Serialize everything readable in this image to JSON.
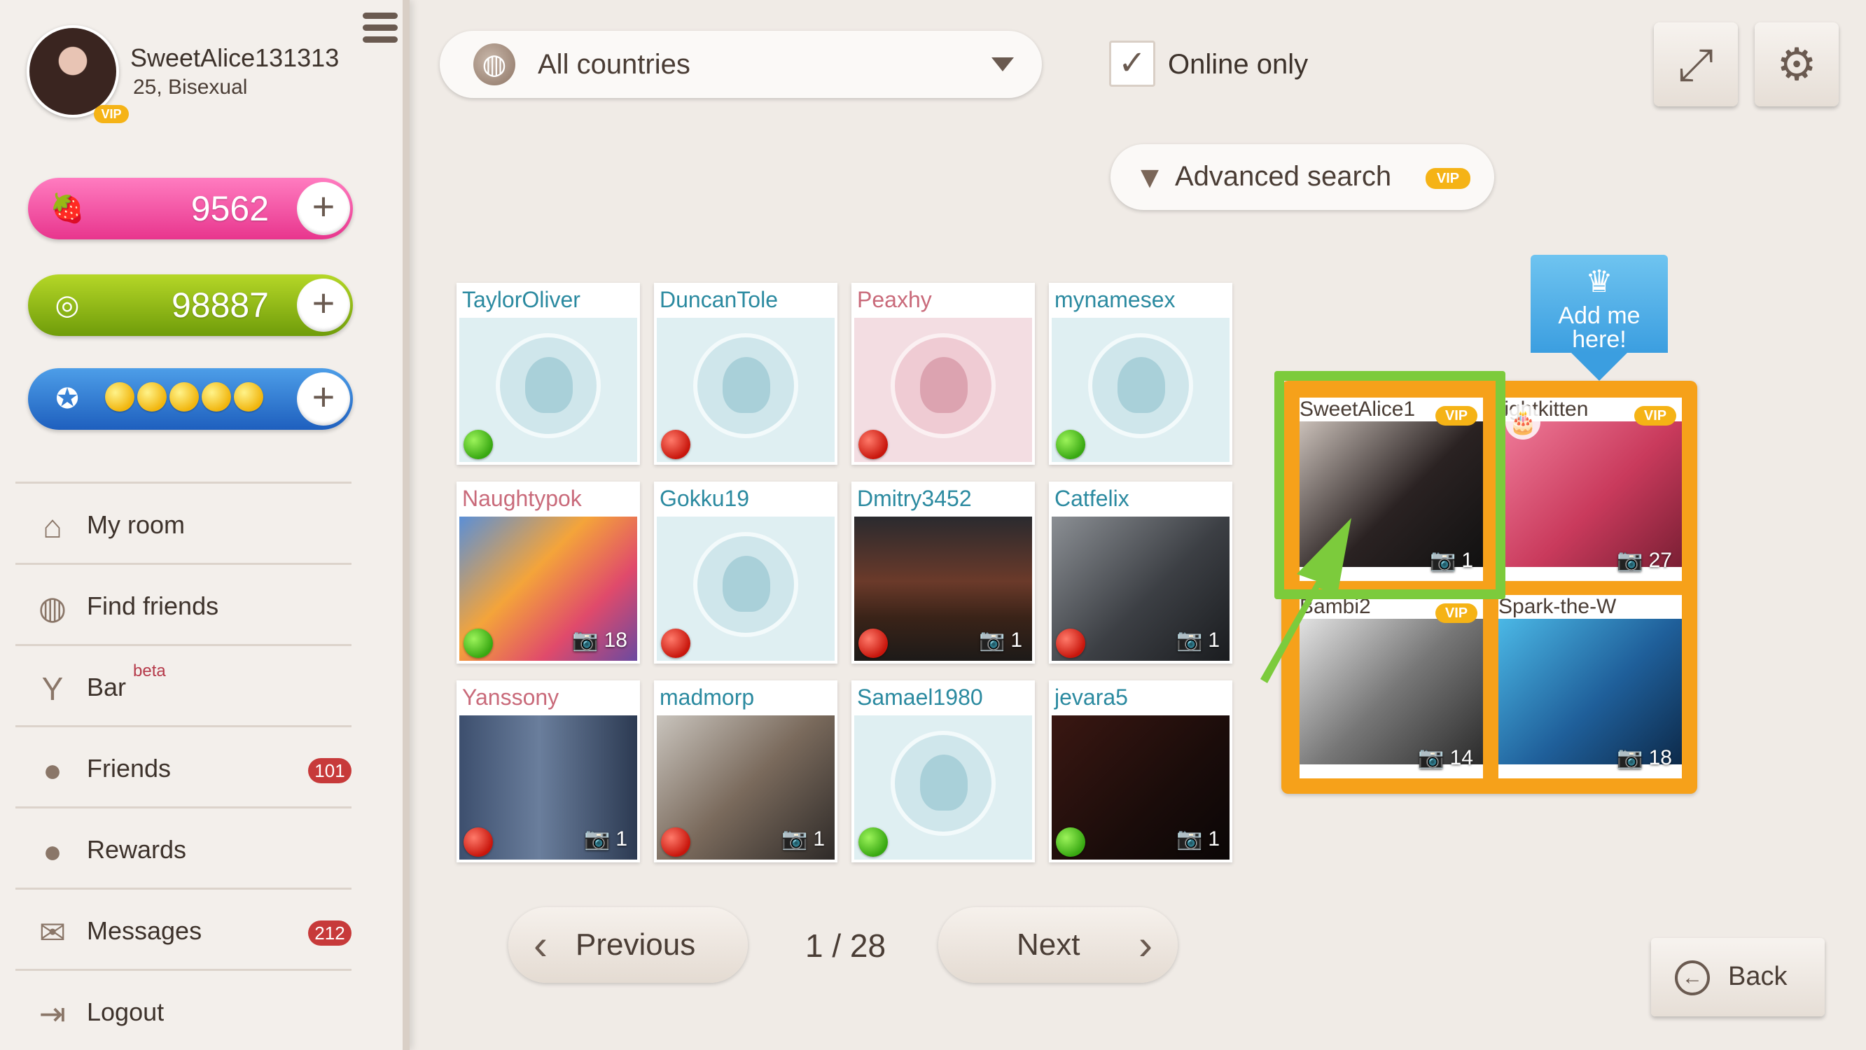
{
  "profile": {
    "username": "SweetAlice131313",
    "meta": "25, Bisexual",
    "vip_label": "VIP"
  },
  "currencies": {
    "strawberries": "9562",
    "coins": "98887",
    "rating_plus": "+"
  },
  "nav": {
    "my_room": "My room",
    "find_friends": "Find friends",
    "bar": "Bar",
    "bar_badge": "beta",
    "friends": "Friends",
    "friends_count": "101",
    "rewards": "Rewards",
    "messages": "Messages",
    "messages_count": "212",
    "logout": "Logout"
  },
  "filters": {
    "country": "All countries",
    "online_only": "Online only",
    "advanced_search": "Advanced search",
    "vip_label": "VIP"
  },
  "cards": [
    {
      "name": "TaylorOliver",
      "photos": ""
    },
    {
      "name": "DuncanTole",
      "photos": ""
    },
    {
      "name": "Peaxhy",
      "photos": ""
    },
    {
      "name": "mynamesex",
      "photos": ""
    },
    {
      "name": "Naughtypok",
      "photos": "18"
    },
    {
      "name": "Gokku19",
      "photos": ""
    },
    {
      "name": "Dmitry3452",
      "photos": "1"
    },
    {
      "name": "Catfelix",
      "photos": "1"
    },
    {
      "name": "Yanssony",
      "photos": "1"
    },
    {
      "name": "madmorp",
      "photos": "1"
    },
    {
      "name": "Samael1980",
      "photos": ""
    },
    {
      "name": "jevara5",
      "photos": "1"
    }
  ],
  "featured": {
    "add_me": "Add me here!",
    "vip_label": "VIP",
    "items": [
      {
        "name": "SweetAlice1",
        "photos": "1"
      },
      {
        "name": "tightkitten",
        "photos": "27"
      },
      {
        "name": "Bambi2",
        "photos": "14"
      },
      {
        "name": "Spark-the-W",
        "photos": "18"
      }
    ]
  },
  "pagination": {
    "previous": "Previous",
    "next": "Next",
    "indicator": "1 / 28"
  },
  "back": "Back",
  "colors": {
    "accent_orange": "#f6a11a",
    "highlight_green": "#7ccb3c",
    "online": "#38a812",
    "offline": "#c8160c",
    "vip_gold": "#f5b316"
  }
}
